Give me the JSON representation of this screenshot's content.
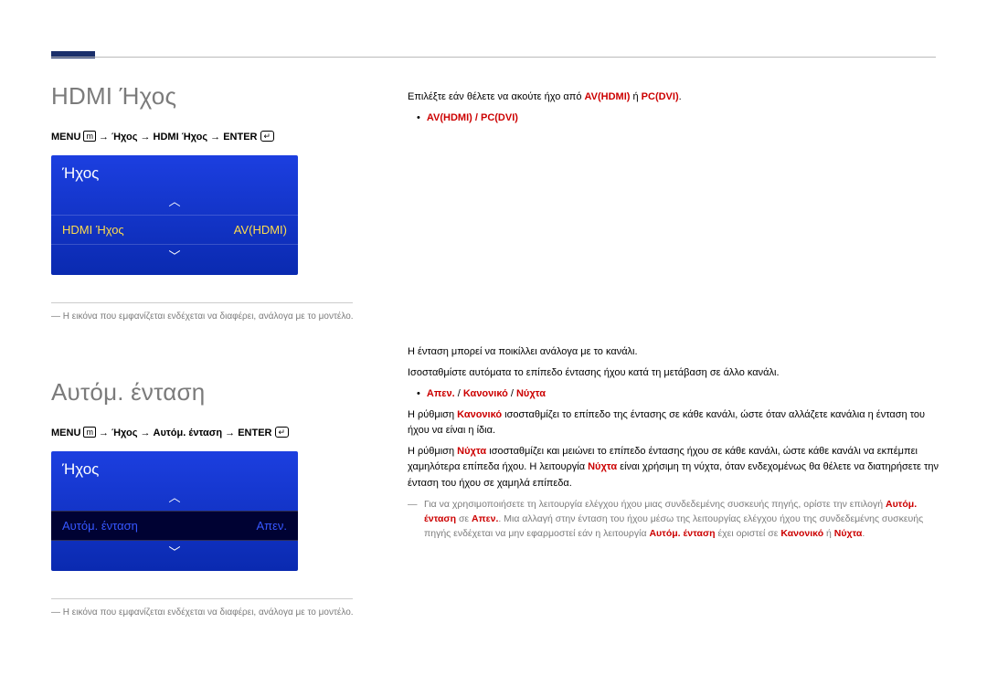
{
  "section1": {
    "title": "HDMI Ήχος",
    "breadcrumb": {
      "menu": "MENU",
      "p1": "Ήχος",
      "p2": "HDMI Ήχος",
      "enter": "ENTER"
    },
    "menu": {
      "title": "Ήχος",
      "row_label": "HDMI Ήχος",
      "row_value": "AV(HDMI)"
    },
    "footnote": "Η εικόνα που εμφανίζεται ενδέχεται να διαφέρει, ανάλογα με το μοντέλο.",
    "body": {
      "intro_pre": "Επιλέξτε εάν θέλετε να ακούτε ήχο από ",
      "avhdmi": "AV(HDMI)",
      "or": " ή ",
      "pcdvi": "PC(DVI)",
      "period": ".",
      "bullet": "AV(HDMI) / PC(DVI)"
    }
  },
  "section2": {
    "title": "Αυτόμ. ένταση",
    "breadcrumb": {
      "menu": "MENU",
      "p1": "Ήχος",
      "p2": "Αυτόμ. ένταση",
      "enter": "ENTER"
    },
    "menu": {
      "title": "Ήχος",
      "row_label": "Αυτόμ. ένταση",
      "row_value": "Απεν."
    },
    "footnote": "Η εικόνα που εμφανίζεται ενδέχεται να διαφέρει, ανάλογα με το μοντέλο.",
    "body": {
      "p1": "Η ένταση μπορεί να ποικίλλει ανάλογα με το κανάλι.",
      "p2": "Ισοσταθμίστε αυτόματα το επίπεδο έντασης ήχου κατά τη μετάβαση σε άλλο κανάλι.",
      "bullet_off": "Απεν.",
      "bullet_sep": " / ",
      "bullet_normal": "Κανονικό",
      "bullet_night": "Νύχτα",
      "p3_pre": "Η ρύθμιση ",
      "p3_normal": "Κανονικό",
      "p3_rest": " ισοσταθμίζει το επίπεδο της έντασης σε κάθε κανάλι, ώστε όταν αλλάζετε κανάλια η ένταση του ήχου να είναι η ίδια.",
      "p4_pre": "Η ρύθμιση ",
      "p4_night": "Νύχτα",
      "p4_mid": " ισοσταθμίζει και μειώνει το επίπεδο έντασης ήχου σε κάθε κανάλι, ώστε κάθε κανάλι να εκπέμπει χαμηλότερα επίπεδα ήχου. Η λειτουργία ",
      "p4_night2": "Νύχτα",
      "p4_end": " είναι χρήσιμη τη νύχτα, όταν ενδεχομένως θα θέλετε να διατηρήσετε την ένταση του ήχου σε χαμηλά επίπεδα.",
      "note_pre": "Για να χρησιμοποιήσετε τη λειτουργία ελέγχου ήχου μιας συνδεδεμένης συσκευής πηγής, ορίστε την επιλογή ",
      "note_av": "Αυτόμ. ένταση",
      "note_to": " σε ",
      "note_off": "Απεν.",
      "note_mid": ". Μια αλλαγή στην ένταση του ήχου μέσω της λειτουργίας ελέγχου ήχου της συνδεδεμένης συσκευής πηγής ενδέχεται να μην εφαρμοστεί εάν η λειτουργία ",
      "note_av2": "Αυτόμ. ένταση",
      "note_set": " έχει οριστεί σε ",
      "note_normal": "Κανονικό",
      "note_or": " ή ",
      "note_night": "Νύχτα",
      "note_period": "."
    }
  },
  "arrows": {
    "up": "︿",
    "down": "﹀"
  },
  "icons": {
    "menu": "m",
    "enter": "↵"
  }
}
